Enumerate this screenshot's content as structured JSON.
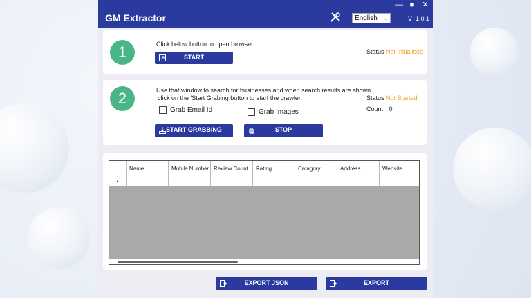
{
  "app": {
    "title": "GM Extractor",
    "version": "V- 1.0.1",
    "language": "English"
  },
  "window_controls": {
    "minimize": "—",
    "maximize": "■",
    "close": "✕"
  },
  "step1": {
    "number": "1",
    "instruction": "Click below button to open browser",
    "start_label": "START",
    "status_label": "Status",
    "status_value": "Not Initialised"
  },
  "step2": {
    "number": "2",
    "instruction_line1": "Use that window to search for businesses and when search results are shown",
    "instruction_line2": "click on the 'Start Grabing button to start the crawler.",
    "grab_email_label": "Grab Email Id",
    "grab_images_label": "Grab Images",
    "start_grabbing_label": "START GRABBING",
    "stop_label": "STOP",
    "status_label": "Status",
    "status_value": "Not Started",
    "count_label": "Count",
    "count_value": "0"
  },
  "table": {
    "columns": [
      "Name",
      "Mobile Number",
      "Review Count",
      "Rating",
      "Catagory",
      "Address",
      "Website"
    ],
    "new_row_marker": "•"
  },
  "footer": {
    "export_json_label": "EXPORT JSON",
    "export_label": "EXPORT"
  },
  "colors": {
    "accent": "#2b3a9e",
    "step": "#4bb58a",
    "status": "#f0a020"
  }
}
